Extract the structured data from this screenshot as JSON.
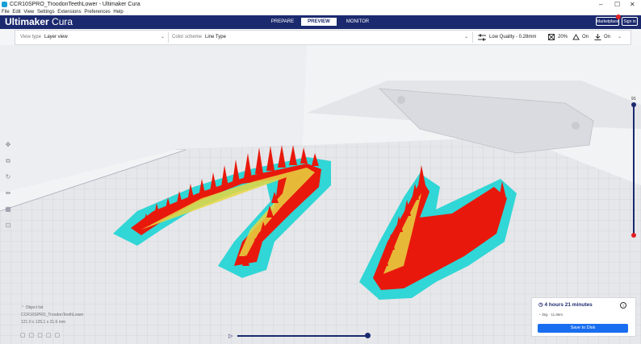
{
  "window": {
    "title": "CCR10SPRO_TroodonTeethLower - Ultimaker Cura",
    "controls": [
      "–",
      "☐",
      "✕"
    ]
  },
  "menu": [
    "File",
    "Edit",
    "View",
    "Settings",
    "Extensions",
    "Preferences",
    "Help"
  ],
  "header": {
    "brand_bold": "Ultimaker",
    "brand_light": " Cura",
    "tabs": [
      {
        "label": "PREPARE",
        "active": false
      },
      {
        "label": "PREVIEW",
        "active": true
      },
      {
        "label": "MONITOR",
        "active": false
      }
    ],
    "marketplace": "Marketplace",
    "signin": "Sign in",
    "accent": "#1b2a6e"
  },
  "toolbar": {
    "view_type_label": "View type",
    "view_type_value": "Layer view",
    "color_scheme_label": "Color scheme",
    "color_scheme_value": "Line Type",
    "quality": "Low Quality - 0.28mm",
    "infill": "20%",
    "support": "On",
    "adhesion": "On"
  },
  "objects": {
    "label": "Object list",
    "name": "CCR10SPRO_TroodonTeethLower",
    "dims": "121.0 x 125.1 x 21.6 mm"
  },
  "layer_slider": {
    "max_layer": "91",
    "handle_color": "#e02020"
  },
  "print_info": {
    "time": "4 hours 21 minutes",
    "material": "35g · 11.86m",
    "save_label": "Save to Disk",
    "save_color": "#196ef0"
  },
  "colors": {
    "wall": "#e8190c",
    "infill": "#e6d642",
    "skirt": "#31d6d6"
  }
}
